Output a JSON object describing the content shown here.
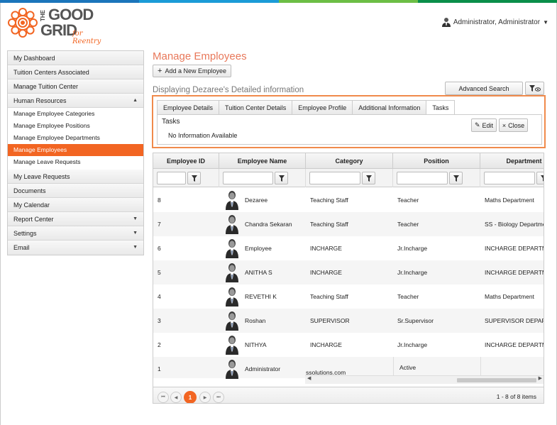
{
  "brand": {
    "the": "THE",
    "good": "GOOD",
    "grid": "GRID",
    "tagline": "for Reentry",
    "accent": "#f26522",
    "stripe_colors": [
      "#1b75bb",
      "#1b9bd7",
      "#6cbe45",
      "#0a8f4a"
    ]
  },
  "user": {
    "name": "Administrator, Administrator",
    "icon": "user-avatar-icon"
  },
  "sidebar": {
    "items": [
      {
        "label": "My Dashboard"
      },
      {
        "label": "Tuition Centers Associated"
      },
      {
        "label": "Manage Tuition Center"
      },
      {
        "label": "Human Resources",
        "arrow": "▲"
      },
      {
        "label": "Manage Employee Categories"
      },
      {
        "label": "Manage Employee Positions"
      },
      {
        "label": "Manage Employee Departments"
      },
      {
        "label": "Manage Employees"
      },
      {
        "label": "Manage Leave Requests"
      },
      {
        "label": "My Leave Requests"
      },
      {
        "label": "Documents"
      },
      {
        "label": "My Calendar"
      },
      {
        "label": "Report Center",
        "arrow": "▼"
      },
      {
        "label": "Settings",
        "arrow": "▼"
      },
      {
        "label": "Email",
        "arrow": "▼"
      }
    ]
  },
  "main": {
    "title": "Manage Employees",
    "add_label": "Add a New Employee",
    "display_info": "Displaying Dezaree's Detailed information",
    "advanced_search": "Advanced Search"
  },
  "detail": {
    "tabs": [
      "Employee Details",
      "Tuition Center Details",
      "Employee Profile",
      "Additional Information",
      "Tasks"
    ],
    "active_tab": "Tasks",
    "panel_title": "Tasks",
    "panel_text": "No Information Available",
    "edit_label": "Edit",
    "close_label": "Close"
  },
  "grid": {
    "columns": [
      "Employee ID",
      "Employee Name",
      "Category",
      "Position",
      "Department"
    ],
    "rows": [
      {
        "id": "8",
        "name": "Dezaree",
        "category": "Teaching Staff",
        "position": "Teacher",
        "department": "Maths Department"
      },
      {
        "id": "7",
        "name": "Chandra Sekaran",
        "category": "Teaching Staff",
        "position": "Teacher",
        "department": "SS - Biology Department"
      },
      {
        "id": "6",
        "name": "Employee",
        "category": "INCHARGE",
        "position": "Jr.Incharge",
        "department": "INCHARGE DEPARTMENT"
      },
      {
        "id": "5",
        "name": "ANITHA S",
        "category": "INCHARGE",
        "position": "Jr.Incharge",
        "department": "INCHARGE DEPARTMENT"
      },
      {
        "id": "4",
        "name": "REVETHI K",
        "category": "Teaching Staff",
        "position": "Teacher",
        "department": "Maths Department"
      },
      {
        "id": "3",
        "name": "Roshan",
        "category": "SUPERVISOR",
        "position": "Sr.Supervisor",
        "department": "SUPERVISOR DEPARTMENT"
      },
      {
        "id": "2",
        "name": "NITHYA",
        "category": "INCHARGE",
        "position": "Jr.Incharge",
        "department": "INCHARGE DEPARTMENT"
      },
      {
        "id": "1",
        "name": "Administrator",
        "category": "ssolutions.com",
        "position": "Active",
        "department": ""
      }
    ]
  },
  "pager": {
    "current": "1",
    "first": "⏮",
    "prev": "◀",
    "next": "▶",
    "last": "⏭",
    "info": "1 - 8 of 8 items"
  }
}
